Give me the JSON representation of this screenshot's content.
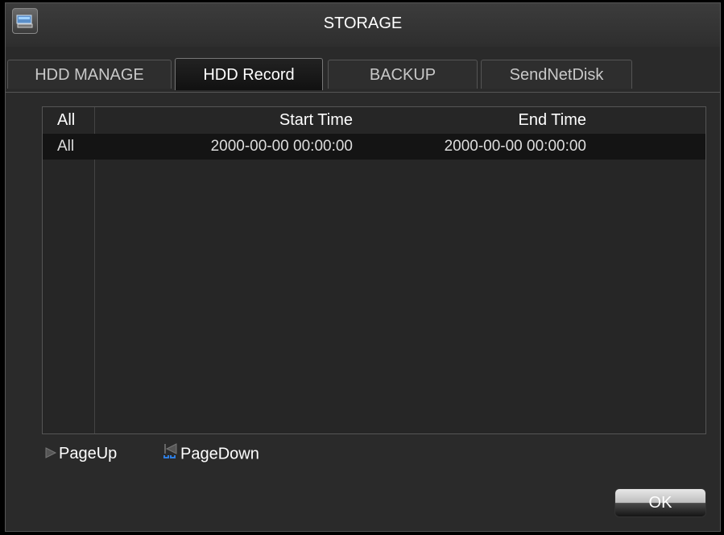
{
  "window": {
    "title": "STORAGE",
    "icon": "storage-disk-icon"
  },
  "tabs": [
    {
      "label": "HDD MANAGE",
      "active": false
    },
    {
      "label": "HDD Record",
      "active": true
    },
    {
      "label": "BACKUP",
      "active": false
    },
    {
      "label": "SendNetDisk",
      "active": false
    }
  ],
  "table": {
    "headers": {
      "all": "All",
      "start": "Start Time",
      "end": "End Time"
    },
    "rows": [
      {
        "all": "All",
        "start": "2000-00-00 00:00:00",
        "end": "2000-00-00 00:00:00"
      }
    ]
  },
  "pager": {
    "up_label": "PageUp",
    "up_icon": "page-up-icon",
    "down_label": "PageDown",
    "down_icon": "page-down-icon"
  },
  "footer": {
    "ok_label": "OK"
  }
}
